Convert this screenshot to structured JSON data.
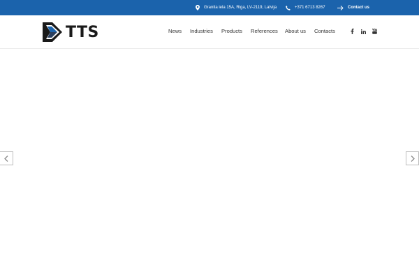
{
  "topbar": {
    "address": "Granita iela 15A, Riga, LV-2119, Latvija",
    "phone": "+371 6713 8267",
    "contact_label": "Contact us",
    "background": "#1b63ac"
  },
  "logo": {
    "text": "TTS"
  },
  "nav": {
    "items": [
      {
        "label": "News"
      },
      {
        "label": "Industries"
      },
      {
        "label": "Products"
      },
      {
        "label": "References"
      },
      {
        "label": "About us"
      },
      {
        "label": "Contacts"
      }
    ]
  },
  "social": [
    "facebook-icon",
    "linkedin-icon",
    "youtube-icon"
  ],
  "slider": {
    "prev_icon": "chevron-left-icon",
    "next_icon": "chevron-right-icon"
  }
}
